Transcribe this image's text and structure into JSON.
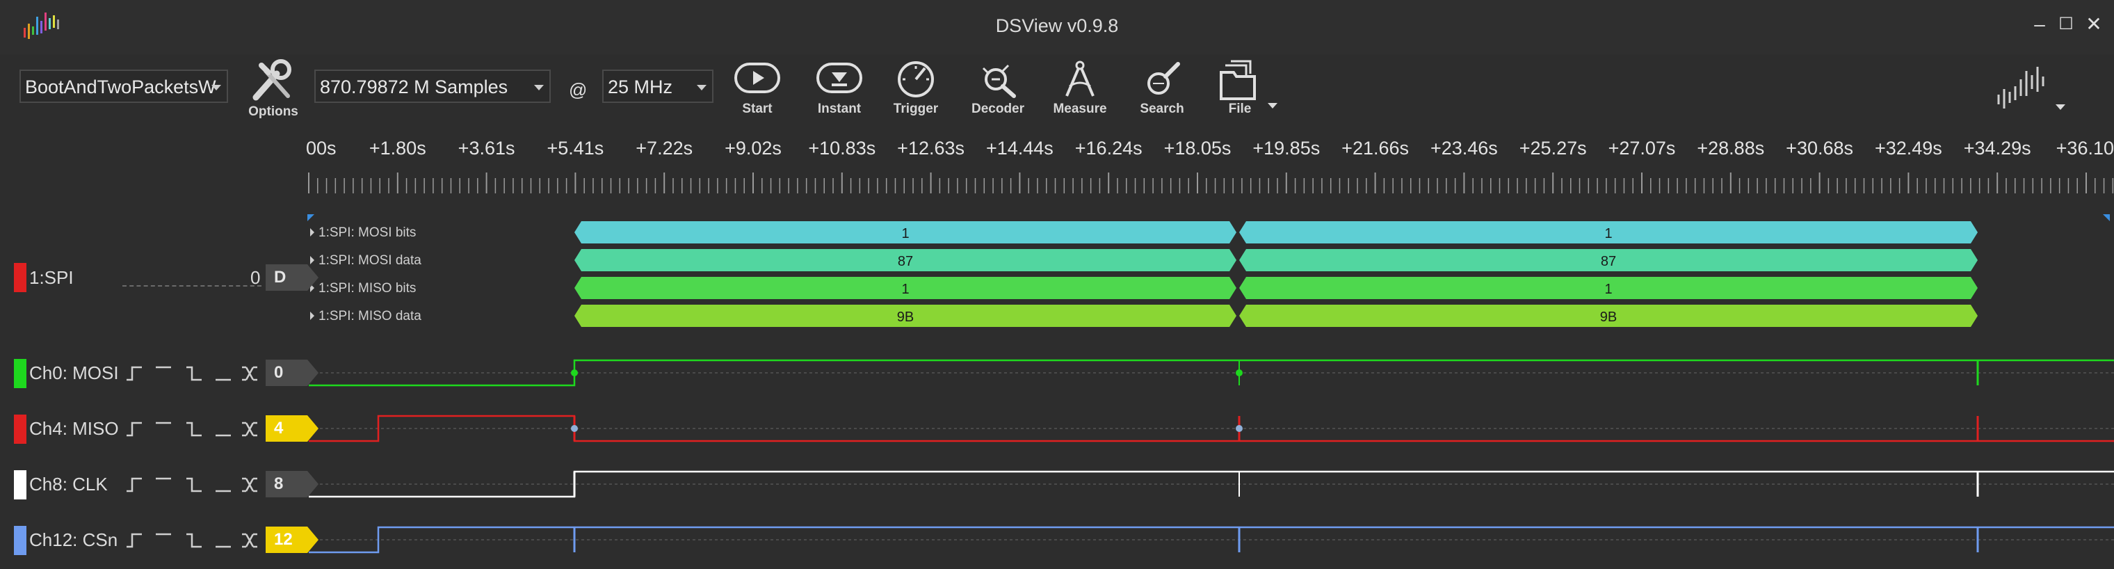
{
  "window": {
    "title": "DSView v0.9.8",
    "controls": {
      "minimize": "–",
      "maximize": "☐",
      "close": "✕"
    }
  },
  "toolbar": {
    "device": "BootAndTwoPacketsW",
    "options_label": "Options",
    "samples": "870.79872 M Samples",
    "at": "@",
    "rate": "25 MHz",
    "buttons": [
      "Start",
      "Instant",
      "Trigger",
      "Decoder",
      "Measure",
      "Search",
      "File"
    ]
  },
  "ruler": {
    "labels": [
      "00s",
      "+1.80s",
      "+3.61s",
      "+5.41s",
      "+7.22s",
      "+9.02s",
      "+10.83s",
      "+12.63s",
      "+14.44s",
      "+16.24s",
      "+18.05s",
      "+19.85s",
      "+21.66s",
      "+23.46s",
      "+25.27s",
      "+27.07s",
      "+28.88s",
      "+30.68s",
      "+32.49s",
      "+34.29s",
      "+36.10"
    ]
  },
  "decoder": {
    "name": "1:SPI",
    "value": "0",
    "chip": "D",
    "rows": [
      {
        "label": "1:SPI: MOSI bits",
        "values": [
          "1",
          "1"
        ],
        "color": "#5ecfd4"
      },
      {
        "label": "1:SPI: MOSI data",
        "values": [
          "87",
          "87"
        ],
        "color": "#52d6a0"
      },
      {
        "label": "1:SPI: MISO bits",
        "values": [
          "1",
          "1"
        ],
        "color": "#4ed84e"
      },
      {
        "label": "1:SPI: MISO data",
        "values": [
          "9B",
          "9B"
        ],
        "color": "#8ad634"
      }
    ]
  },
  "channels": [
    {
      "name": "Ch0: MOSI",
      "index": "0",
      "color": "#1ed81e",
      "chip_bg": "#4a4a4a",
      "chip_fg": "#e6e6e6"
    },
    {
      "name": "Ch4: MISO",
      "index": "4",
      "color": "#e02020",
      "chip_bg": "#f0d000",
      "chip_fg": "#ffffff"
    },
    {
      "name": "Ch8: CLK",
      "index": "8",
      "color": "#ffffff",
      "chip_bg": "#4a4a4a",
      "chip_fg": "#e6e6e6"
    },
    {
      "name": "Ch12: CSn",
      "index": "12",
      "color": "#6f9cf0",
      "chip_bg": "#f0d000",
      "chip_fg": "#ffffff"
    }
  ],
  "trigger_glyphs": "_/‾ ‾ ‾\\_ _ ><"
}
